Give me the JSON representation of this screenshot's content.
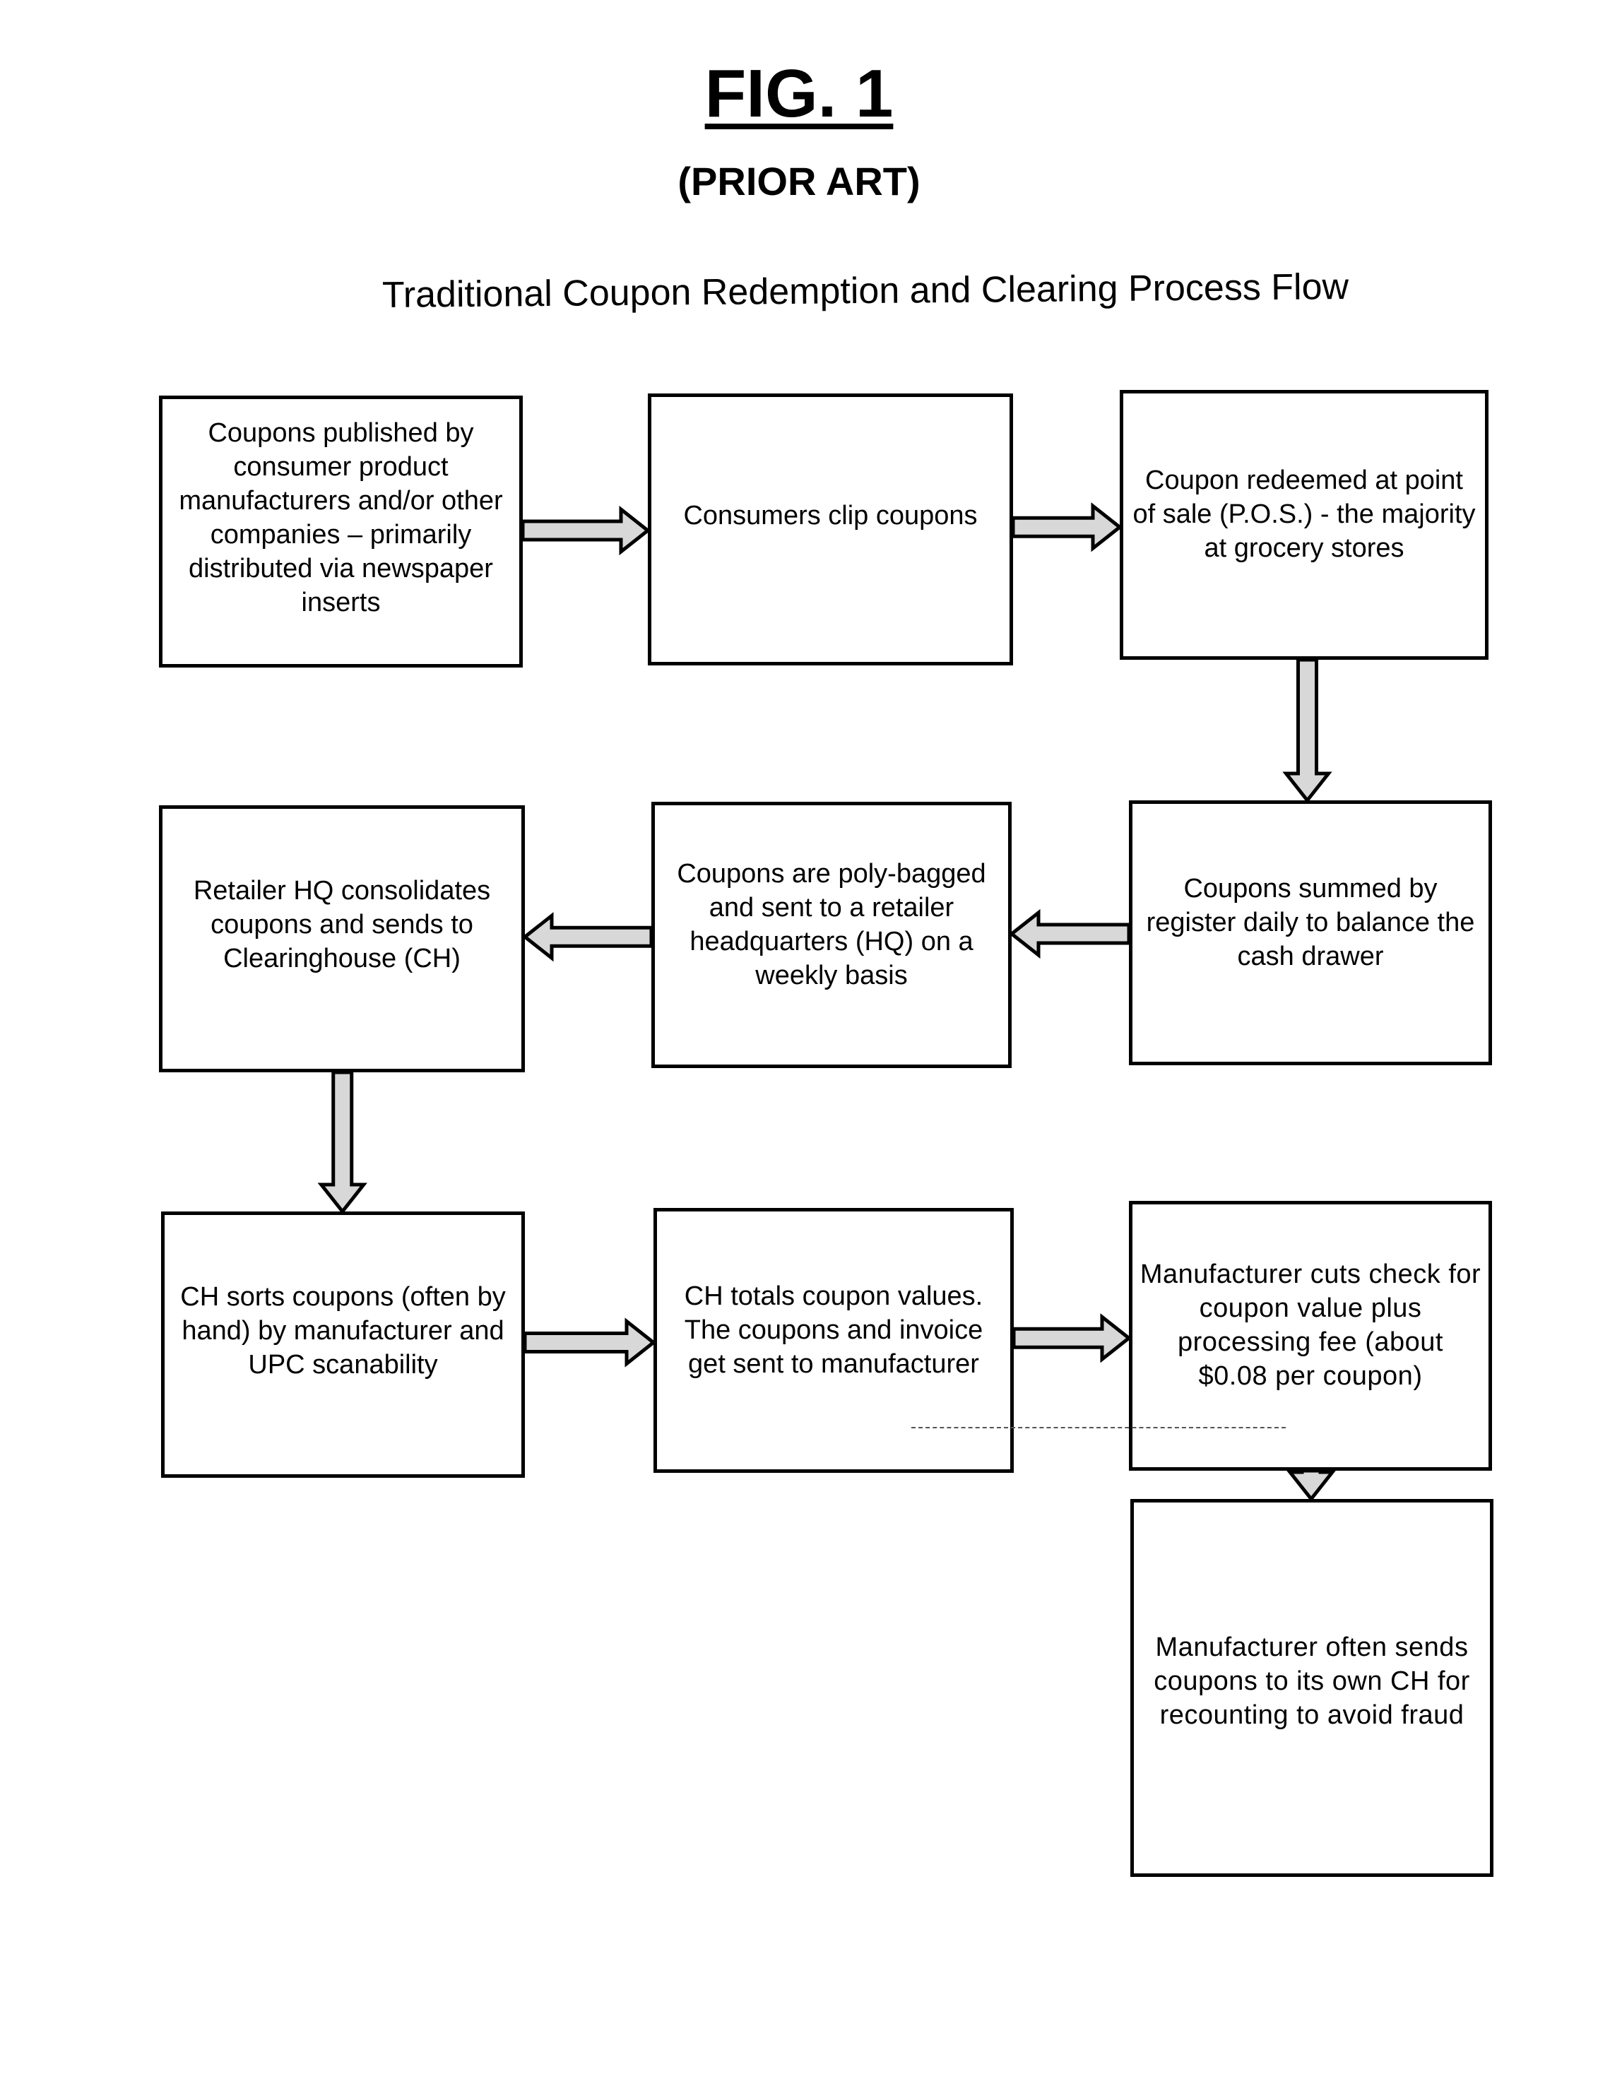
{
  "figure": {
    "label": "FIG. 1",
    "note": "(PRIOR ART)",
    "title": "Traditional Coupon Redemption and Clearing Process Flow"
  },
  "colors": {
    "stroke": "#000000",
    "arrow_fill": "#d8d8d8",
    "background": "#ffffff"
  },
  "steps": [
    {
      "id": 1,
      "text": "Coupons published by consumer product manufacturers and/or other companies – primarily distributed via newspaper inserts"
    },
    {
      "id": 2,
      "text": "Consumers clip coupons"
    },
    {
      "id": 3,
      "text": "Coupon redeemed at point of sale (P.O.S.) - the majority at grocery stores"
    },
    {
      "id": 4,
      "text": "Coupons summed by register daily to balance the cash drawer"
    },
    {
      "id": 5,
      "text": "Coupons are poly-bagged and sent to a retailer headquarters (HQ) on a weekly basis"
    },
    {
      "id": 6,
      "text": "Retailer HQ consolidates coupons and sends to Clearinghouse (CH)"
    },
    {
      "id": 7,
      "text": "CH sorts coupons (often by hand) by manufacturer and UPC scanability"
    },
    {
      "id": 8,
      "text": "CH totals coupon values. The coupons and invoice get sent to manufacturer"
    },
    {
      "id": 9,
      "text": "Manufacturer cuts check for coupon value plus processing fee (about $0.08 per coupon)"
    },
    {
      "id": 10,
      "text": "Manufacturer often sends coupons to its own CH for recounting to avoid fraud"
    }
  ],
  "connections": [
    {
      "from": 1,
      "to": 2,
      "direction": "right"
    },
    {
      "from": 2,
      "to": 3,
      "direction": "right"
    },
    {
      "from": 3,
      "to": 4,
      "direction": "down"
    },
    {
      "from": 4,
      "to": 5,
      "direction": "left"
    },
    {
      "from": 5,
      "to": 6,
      "direction": "left"
    },
    {
      "from": 6,
      "to": 7,
      "direction": "down"
    },
    {
      "from": 7,
      "to": 8,
      "direction": "right"
    },
    {
      "from": 8,
      "to": 9,
      "direction": "right"
    },
    {
      "from": 9,
      "to": 10,
      "direction": "down"
    }
  ]
}
